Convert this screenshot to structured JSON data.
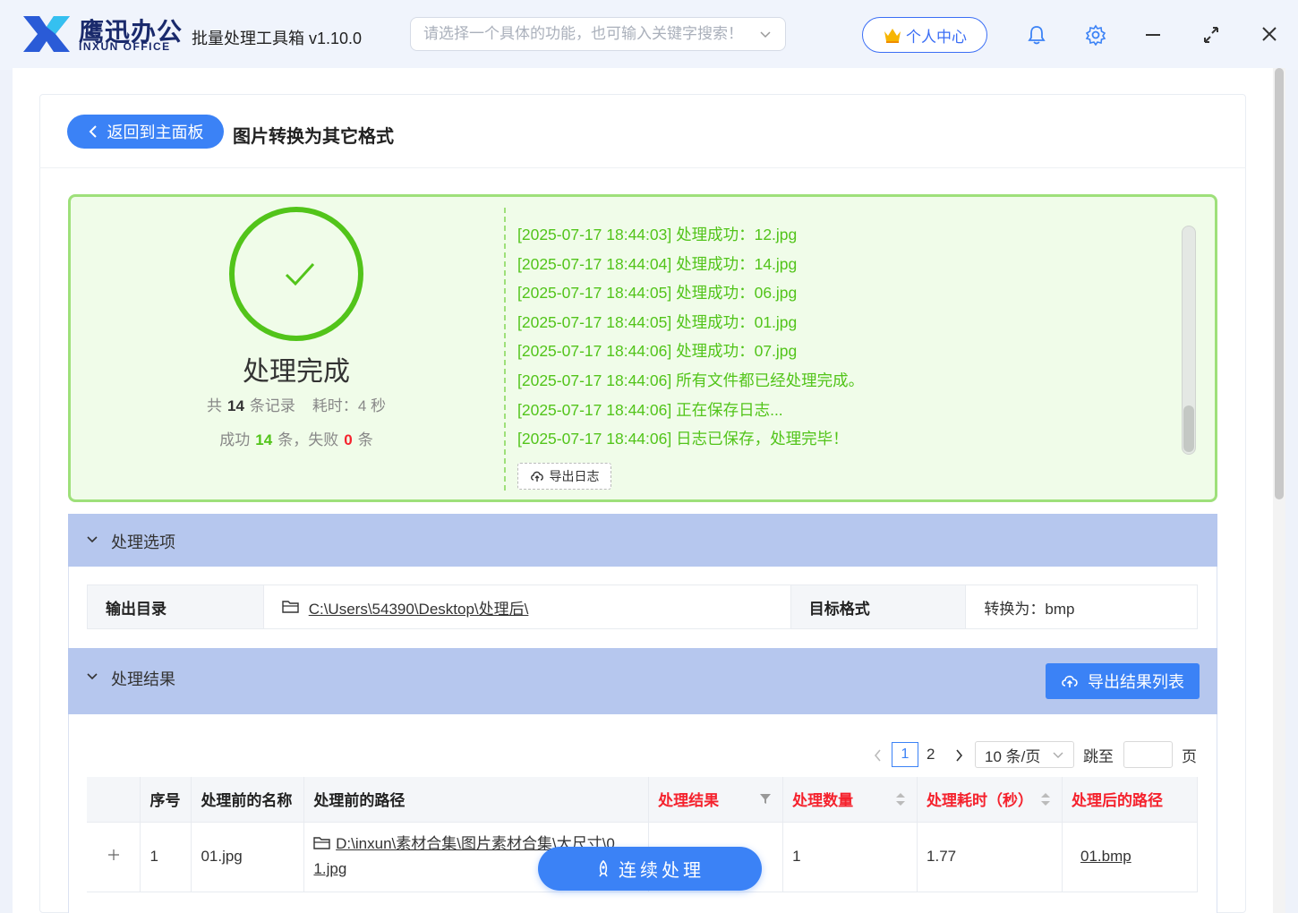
{
  "brand": {
    "cn": "鹰迅办公",
    "en": "INXUN OFFICE"
  },
  "app_title": "批量处理工具箱 v1.10.0",
  "search": {
    "placeholder": "请选择一个具体的功能，也可输入关键字搜索！"
  },
  "user_center": "个人中心",
  "back_button": "返回到主面板",
  "page_title": "图片转换为其它格式",
  "result": {
    "status": "处理完成",
    "total_prefix": "共",
    "total": "14",
    "total_suffix": "条记录",
    "time_prefix": "耗时：",
    "time_value": "4 秒",
    "success_prefix": "成功",
    "success": "14",
    "fail_prefix": "条，失败",
    "fail": "0",
    "fail_suffix": "条"
  },
  "log": [
    "[2025-07-17 18:44:03] 处理成功：12.jpg",
    "[2025-07-17 18:44:04] 处理成功：14.jpg",
    "[2025-07-17 18:44:05] 处理成功：06.jpg",
    "[2025-07-17 18:44:05] 处理成功：01.jpg",
    "[2025-07-17 18:44:06] 处理成功：07.jpg",
    "[2025-07-17 18:44:06] 所有文件都已经处理完成。",
    "[2025-07-17 18:44:06] 正在保存日志...",
    "[2025-07-17 18:44:06] 日志已保存，处理完毕！"
  ],
  "export_log": "导出日志",
  "options": {
    "title": "处理选项",
    "output_dir_label": "输出目录",
    "output_dir": "C:\\Users\\54390\\Desktop\\处理后\\",
    "format_label": "目标格式",
    "format_value": "转换为：bmp"
  },
  "results": {
    "title": "处理结果",
    "export_button": "导出结果列表",
    "pagination": {
      "pages": [
        "1",
        "2"
      ],
      "page_size": "10 条/页",
      "jump_label": "跳至",
      "page_unit": "页"
    },
    "columns": [
      "序号",
      "处理前的名称",
      "处理前的路径",
      "处理结果",
      "处理数量",
      "处理耗时（秒）",
      "处理后的路径"
    ],
    "rows": [
      {
        "index": "1",
        "name": "01.jpg",
        "path_line1": "D:\\inxun\\素材合集\\图片素材合集\\大尺寸\\0",
        "path_line2": "1.jpg",
        "count": "1",
        "time": "1.77",
        "out": "01.bmp"
      }
    ]
  },
  "continue_button": "连续处理",
  "colors": {
    "accent": "#3b82f6",
    "success": "#52c41a",
    "danger": "#f5222d",
    "section": "#b6c7ee"
  }
}
